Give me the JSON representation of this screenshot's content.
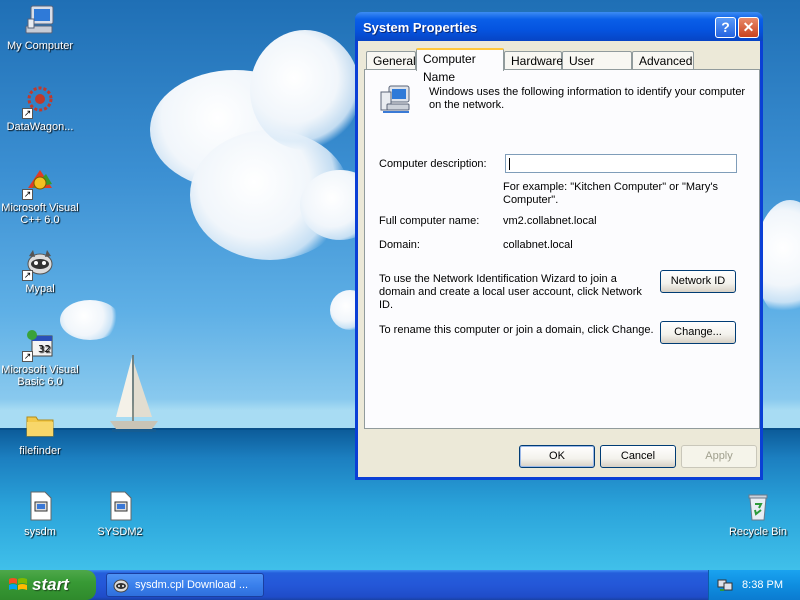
{
  "desktop_icons": [
    {
      "label": "My Computer",
      "icon": "my-computer-icon"
    },
    {
      "label": "DataWagon...",
      "icon": "datawagon-icon"
    },
    {
      "label": "Microsoft Visual C++ 6.0",
      "icon": "visual-cpp-icon"
    },
    {
      "label": "Mypal",
      "icon": "mypal-icon"
    },
    {
      "label": "Microsoft Visual Basic 6.0",
      "icon": "visual-basic-icon"
    },
    {
      "label": "filefinder",
      "icon": "folder-icon"
    },
    {
      "label": "sysdm",
      "icon": "cpl-file-icon"
    },
    {
      "label": "SYSDM2",
      "icon": "cpl-file-icon"
    },
    {
      "label": "Recycle Bin",
      "icon": "recycle-bin-icon"
    }
  ],
  "window": {
    "title": "System Properties",
    "help_glyph": "?",
    "close_glyph": "✕",
    "tabs": [
      "General",
      "Computer Name",
      "Hardware",
      "User Profiles",
      "Advanced"
    ],
    "active_tab": "Computer Name",
    "intro": "Windows uses the following information to identify your computer on the network.",
    "description_label": "Computer description:",
    "description_value": "",
    "example": "For example: \"Kitchen Computer\" or \"Mary's Computer\".",
    "full_name_label": "Full computer name:",
    "full_name_value": "vm2.collabnet.local",
    "domain_label": "Domain:",
    "domain_value": "collabnet.local",
    "network_id_text": "To use the Network Identification Wizard to join a domain and create a local user account, click Network ID.",
    "network_id_button": "Network ID",
    "change_text": "To rename this computer or join a domain, click Change.",
    "change_button": "Change...",
    "ok_button": "OK",
    "cancel_button": "Cancel",
    "apply_button": "Apply"
  },
  "taskbar": {
    "start_label": "start",
    "task_label": "sysdm.cpl Download ...",
    "clock": "8:38 PM"
  },
  "colors": {
    "xp_blue": "#0554e0",
    "start_green": "#389a35",
    "dialog_face": "#ece9d8",
    "tab_highlight": "#ffc83c"
  }
}
